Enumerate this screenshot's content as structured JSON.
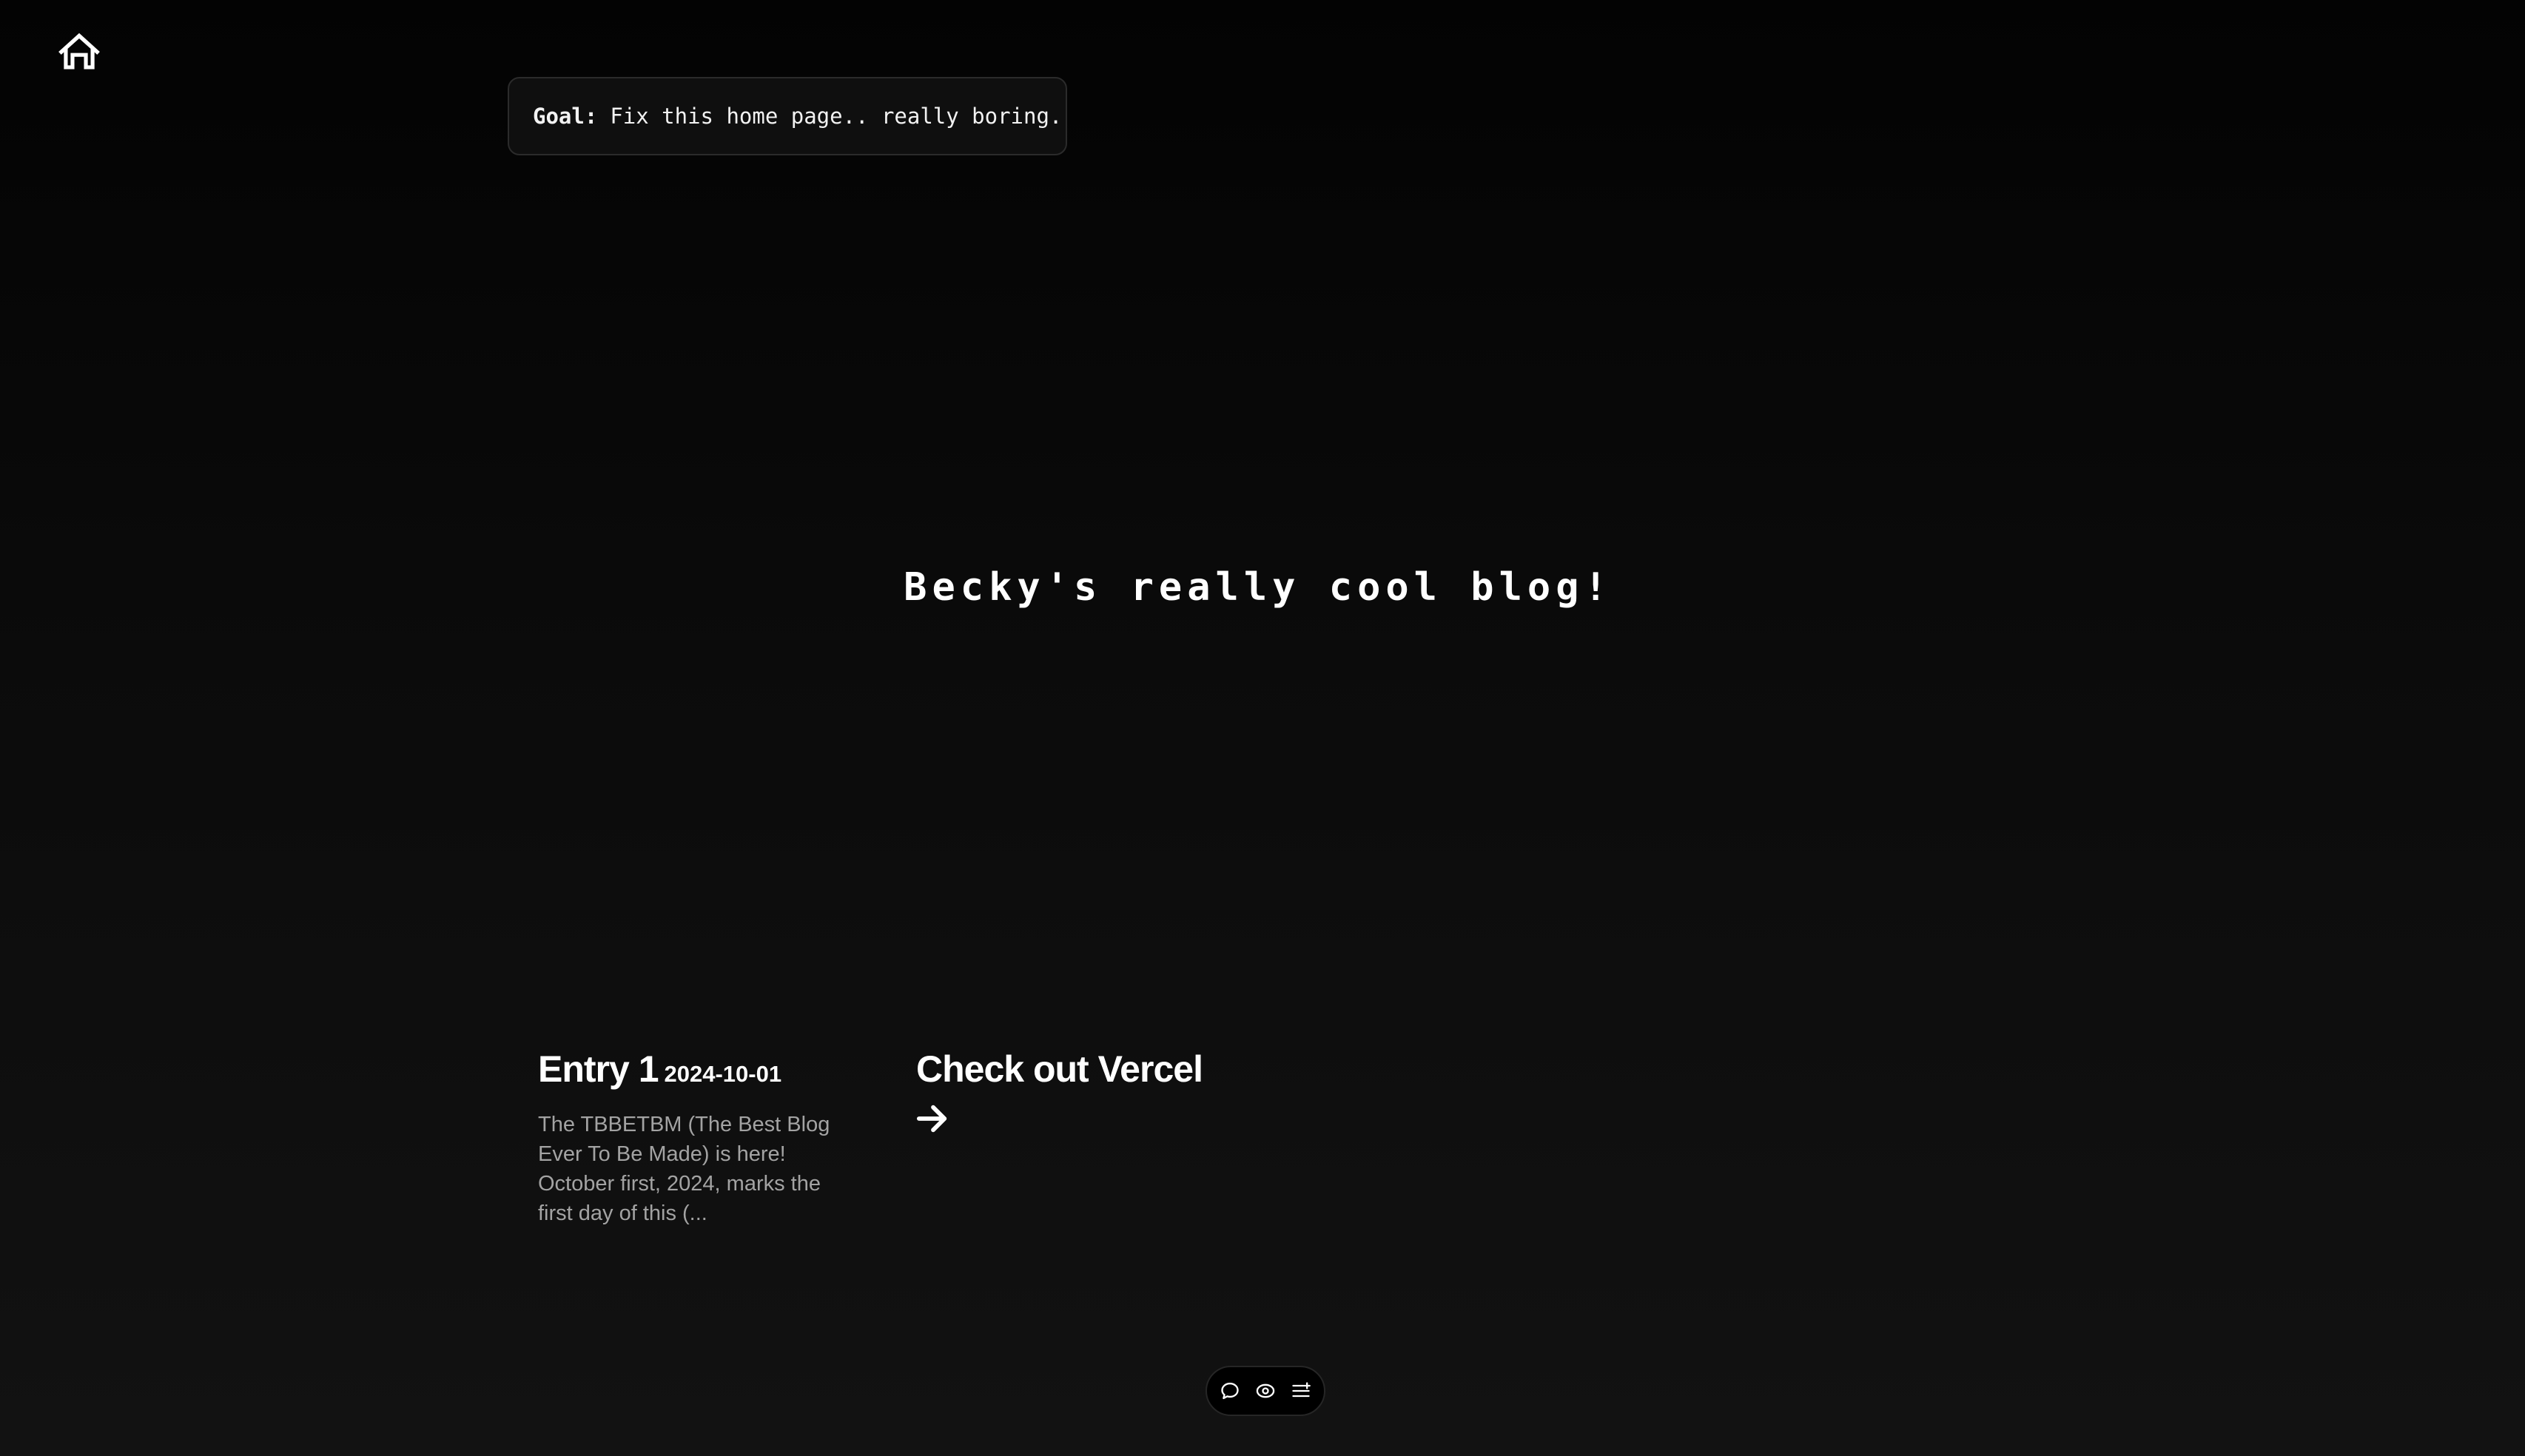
{
  "nav": {
    "home_icon": "home-icon"
  },
  "goal": {
    "label": "Goal:",
    "text": "Fix this home page.. really boring."
  },
  "hero": {
    "title": "Becky's really cool blog!"
  },
  "entries": [
    {
      "title": "Entry 1",
      "date": "2024-10-01",
      "excerpt": "The TBBETBM (The Best Blog Ever To Be Made) is here! October first, 2024, marks the first day of this (..."
    }
  ],
  "cta": {
    "label": "Check out Vercel",
    "icon": "arrow-right-icon"
  },
  "toolbar": {
    "icons": [
      "comment-icon",
      "eye-icon",
      "list-icon"
    ]
  },
  "colors": {
    "background": "#0b0b0b",
    "text": "#ffffff",
    "muted": "#a3a3a3"
  }
}
